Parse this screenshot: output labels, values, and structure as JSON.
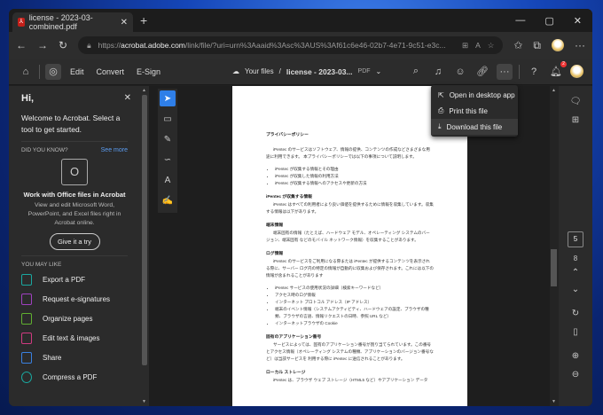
{
  "browser": {
    "tab_title": "license - 2023-03-combined.pdf",
    "url_prefix": "https://",
    "url_domain": "acrobat.adobe.com",
    "url_rest": "/link/file/?uri=urn%3Aaaid%3Asc%3AUS%3Af61c6e46-02b7-4e71-9c51-e3c..."
  },
  "toolbar": {
    "edit": "Edit",
    "convert": "Convert",
    "esign": "E-Sign",
    "your_files": "Your files",
    "separator": "/",
    "file_name": "license - 2023-03...",
    "file_type": "PDF",
    "notification_count": "2"
  },
  "menu": {
    "items": [
      "Open in desktop app",
      "Print this file",
      "Download this file"
    ]
  },
  "sidebar": {
    "greeting": "Hi,",
    "welcome": "Welcome to Acrobat. Select a tool to get started.",
    "did_you_know": "DID YOU KNOW?",
    "see_more": "See more",
    "promo_title": "Work with Office files in Acrobat",
    "promo_desc": "View and edit Microsoft Word, PowerPoint, and Excel files right in Acrobat online.",
    "try_button": "Give it a try",
    "you_may_like": "YOU MAY LIKE",
    "items": [
      {
        "label": "Export a PDF",
        "color": "#1aa8a0"
      },
      {
        "label": "Request e-signatures",
        "color": "#a040c0"
      },
      {
        "label": "Organize pages",
        "color": "#60b030"
      },
      {
        "label": "Edit text & images",
        "color": "#d03a80"
      },
      {
        "label": "Share",
        "color": "#3a80e0"
      },
      {
        "label": "Compress a PDF",
        "color": "#1aa8a0"
      }
    ]
  },
  "page_nav": {
    "current": "5",
    "total": "8"
  },
  "document": {
    "h1": "プライバシーポリシー",
    "p1": "iPentec のサービスはソフトウェア、情報の提供、コンテンツの作成などさまざまな用途に利用できます。 本プライバシーポリシーでは以下の事項について説明します。",
    "list1": [
      "iPentec が収集する情報とその理由",
      "iPentec が収集した情報の利用方法",
      "iPentec が収集する情報へのアクセスや更新の方法"
    ],
    "h2": "iPentec が収集する情報",
    "p2": "iPentec はすべての利用者により良い価値を提供するために情報を収集しています。収集する情報は以下があります。",
    "h3": "端末情報",
    "p3": "端末固有の情報（たとえば、ハードウェア モデル、オペレーティング システムのバージョン、端末固有 などのモバイル ネットワーク情報）を収集することがあります。",
    "h4": "ログ情報",
    "p4": "iPentec のサービスをご利用になる際または iPentec が提供するコンテンツを表示される際に、サーバー ログ内の特定の情報が自動的に収集および保存されます。これには以下の情報が含まれることがあります",
    "list2": [
      "iPentec サービスの使用状況の詳細（検索キーワードなど）",
      "アクセス時のログ情報",
      "インターネット プロトコル アドレス（IP アドレス）",
      "端末のイベント情報（システムアクティビティ、ハードウェアの設定、ブラウザの種類、ブラウザの言語、情報リクエストの日時、参照 URL など）",
      "インターネットブラウザの Cookie"
    ],
    "h5": "固有のアプリケーション番号",
    "p5": "サービスによっては、固有のアプリケーション番号が割り当てられています。この番号とアクセス情報（オペレーティング システムの種類、アプリケーションのバージョン番号など）は当該サービスを 利用する際に iPentec に送信されることがあります。",
    "h6": "ローカル ストレージ",
    "p6": "iPentec は、ブラウザ ウェブ ストレージ（HTML5 など）やアプリケーション データ"
  }
}
